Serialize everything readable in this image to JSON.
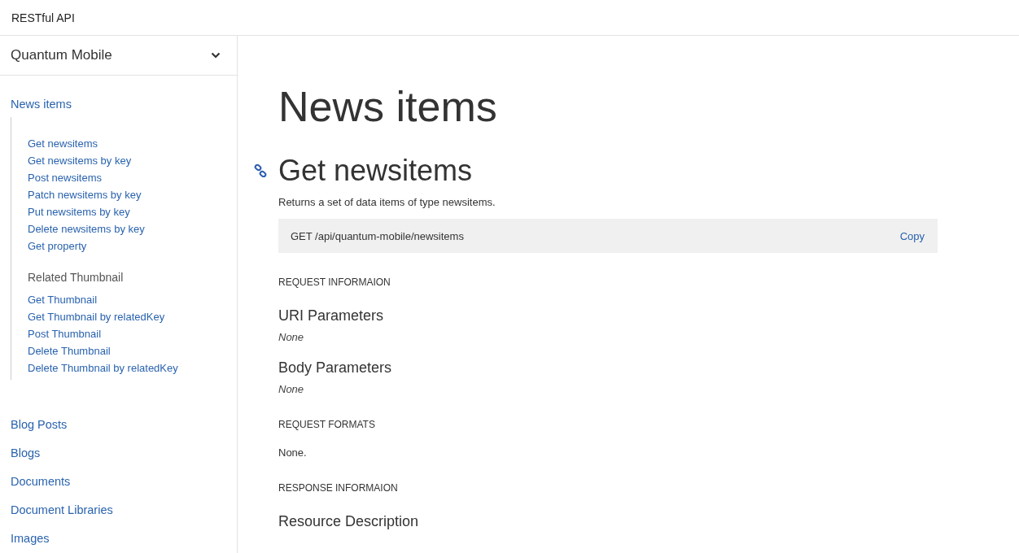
{
  "header": {
    "title": "RESTful API"
  },
  "sidebar": {
    "selector": {
      "label": "Quantum Mobile"
    },
    "groups": [
      {
        "label": "News items",
        "sections": [
          {
            "links": [
              "Get newsitems",
              "Get newsitems by key",
              "Post newsitems",
              "Patch newsitems by key",
              "Put newsitems by key",
              "Delete newsitems by key",
              "Get property"
            ]
          },
          {
            "title": "Related Thumbnail",
            "links": [
              "Get Thumbnail",
              "Get Thumbnail by relatedKey",
              "Post Thumbnail",
              "Delete Thumbnail",
              "Delete Thumbnail by relatedKey"
            ]
          }
        ]
      },
      {
        "label": "Blog Posts"
      },
      {
        "label": "Blogs"
      },
      {
        "label": "Documents"
      },
      {
        "label": "Document Libraries"
      },
      {
        "label": "Images"
      }
    ]
  },
  "main": {
    "title": "News items",
    "endpoint": {
      "title": "Get newsitems",
      "description": "Returns a set of data items of type newsitems.",
      "request": "GET /api/quantum-mobile/newsitems",
      "copy": "Copy"
    },
    "blocks": [
      {
        "kind": "label",
        "text": "REQUEST INFORMAION"
      },
      {
        "kind": "heading",
        "text": "URI Parameters"
      },
      {
        "kind": "note",
        "text": "None"
      },
      {
        "kind": "heading",
        "text": "Body Parameters"
      },
      {
        "kind": "note",
        "text": "None"
      },
      {
        "kind": "label",
        "text": "REQUEST FORMATS"
      },
      {
        "kind": "text",
        "text": "None."
      },
      {
        "kind": "label",
        "text": "RESPONSE INFORMAION"
      },
      {
        "kind": "heading",
        "text": "Resource Description"
      }
    ]
  }
}
